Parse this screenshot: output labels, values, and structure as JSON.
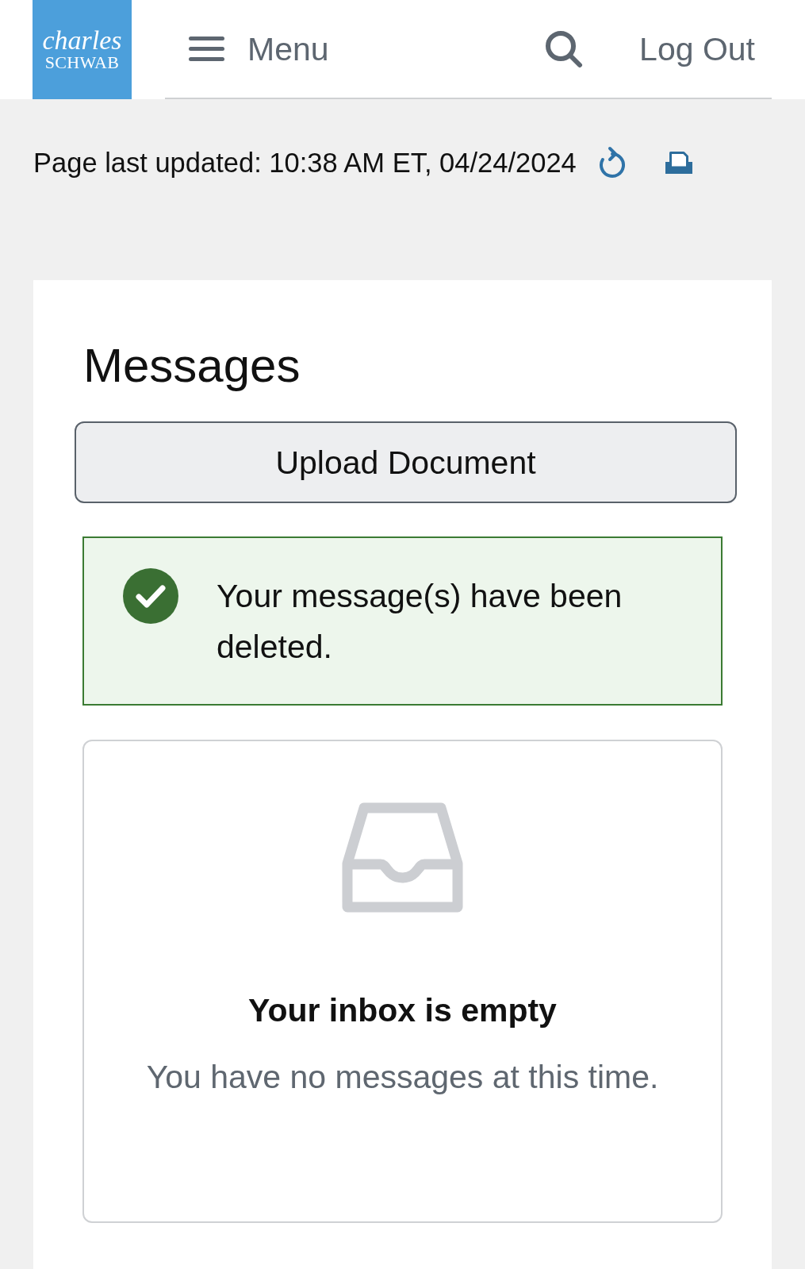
{
  "header": {
    "logo": {
      "line_1": "charles",
      "line_2": "SCHWAB"
    },
    "menu": {
      "label": "Menu"
    },
    "logout": {
      "label": "Log Out"
    }
  },
  "update_bar": {
    "text": "Page last updated: 10:38 AM ET, 04/24/2024"
  },
  "messages": {
    "title": "Messages",
    "upload_button": "Upload Document",
    "alert": {
      "kind": "success",
      "text": "Your message(s) have been deleted."
    },
    "empty_state": {
      "title": "Your inbox is empty",
      "text": "You have no messages at this time."
    }
  }
}
